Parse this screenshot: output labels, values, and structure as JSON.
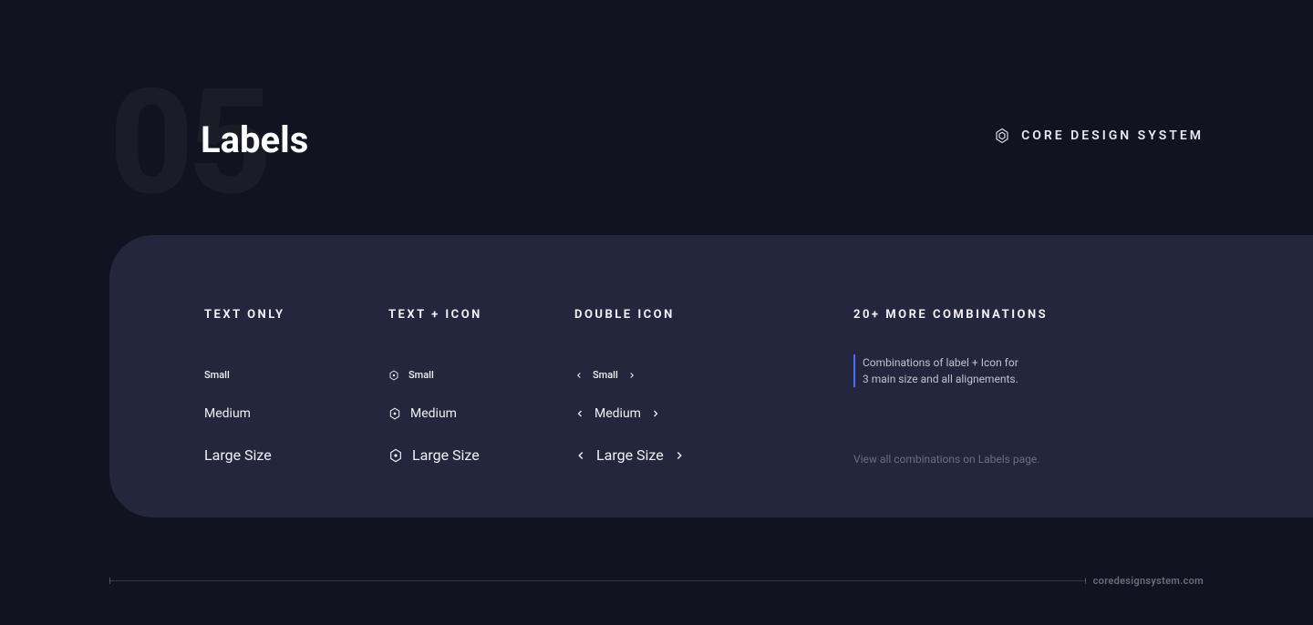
{
  "header": {
    "section_number": "05",
    "section_title": "Labels"
  },
  "brand": {
    "label": "CORE DESIGN SYSTEM"
  },
  "columns": {
    "text_only": {
      "heading": "TEXT ONLY",
      "small": "Small",
      "medium": "Medium",
      "large": "Large Size"
    },
    "text_icon": {
      "heading": "TEXT + ICON",
      "small": "Small",
      "medium": "Medium",
      "large": "Large Size"
    },
    "double_icon": {
      "heading": "DOUBLE ICON",
      "small": "Small",
      "medium": "Medium",
      "large": "Large Size"
    },
    "more": {
      "heading": "20+ MORE COMBINATIONS",
      "desc_line1": "Combinations of label + Icon for",
      "desc_line2": "3 main size and all alignements.",
      "link": "View all combinations on Labels page."
    }
  },
  "footer": {
    "url": "coredesignsystem.com"
  }
}
